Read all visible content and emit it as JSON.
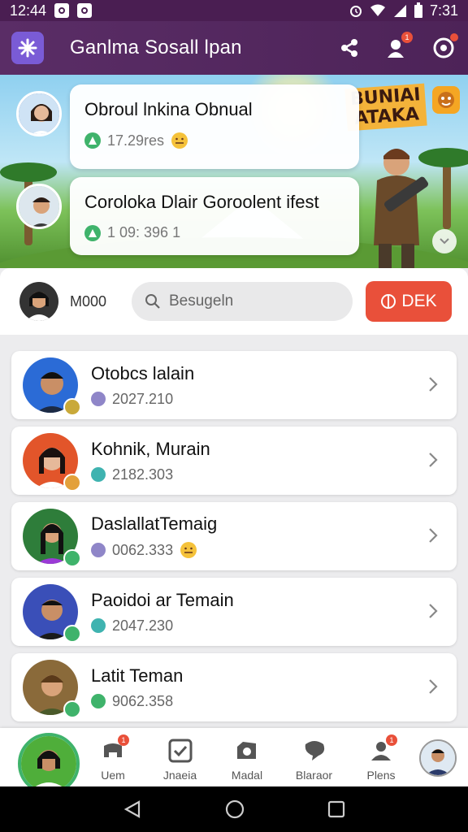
{
  "status_bar": {
    "time_left": "12:44",
    "time_right": "7:31"
  },
  "app": {
    "title": "Ganlma Sosall lpan",
    "header_badge": "1"
  },
  "banner": {
    "game_title_line1": "BUNIAI",
    "game_title_line2": "ATAKA",
    "posts": [
      {
        "title": "Obroul lnkina Obnual",
        "meta": "17.29res"
      },
      {
        "title": "Coroloka Dlair Goroolent ifest",
        "meta": "1 09: 396 1"
      }
    ]
  },
  "search_row": {
    "user_label": "M000",
    "search_value": "Besugeln",
    "cta_label": "DEK"
  },
  "friends": [
    {
      "name": "Otobcs lalain",
      "meta": "2027.210"
    },
    {
      "name": "Kohnik, Murain",
      "meta": "2182.303"
    },
    {
      "name": "DaslallatTemaig",
      "meta": "0062.333"
    },
    {
      "name": "Paoidoi ar Temain",
      "meta": "2047.230"
    },
    {
      "name": "Latit Teman",
      "meta": "9062.358"
    }
  ],
  "bottom_nav": {
    "items": [
      {
        "label": "Uem",
        "badge": "1"
      },
      {
        "label": "Jnaeia",
        "badge": ""
      },
      {
        "label": "Madal",
        "badge": ""
      },
      {
        "label": "Blaraor",
        "badge": ""
      },
      {
        "label": "Plens",
        "badge": "1"
      }
    ]
  },
  "colors": {
    "header": "#5a2d66",
    "accent": "#e9503a",
    "online": "#3fb36b"
  }
}
